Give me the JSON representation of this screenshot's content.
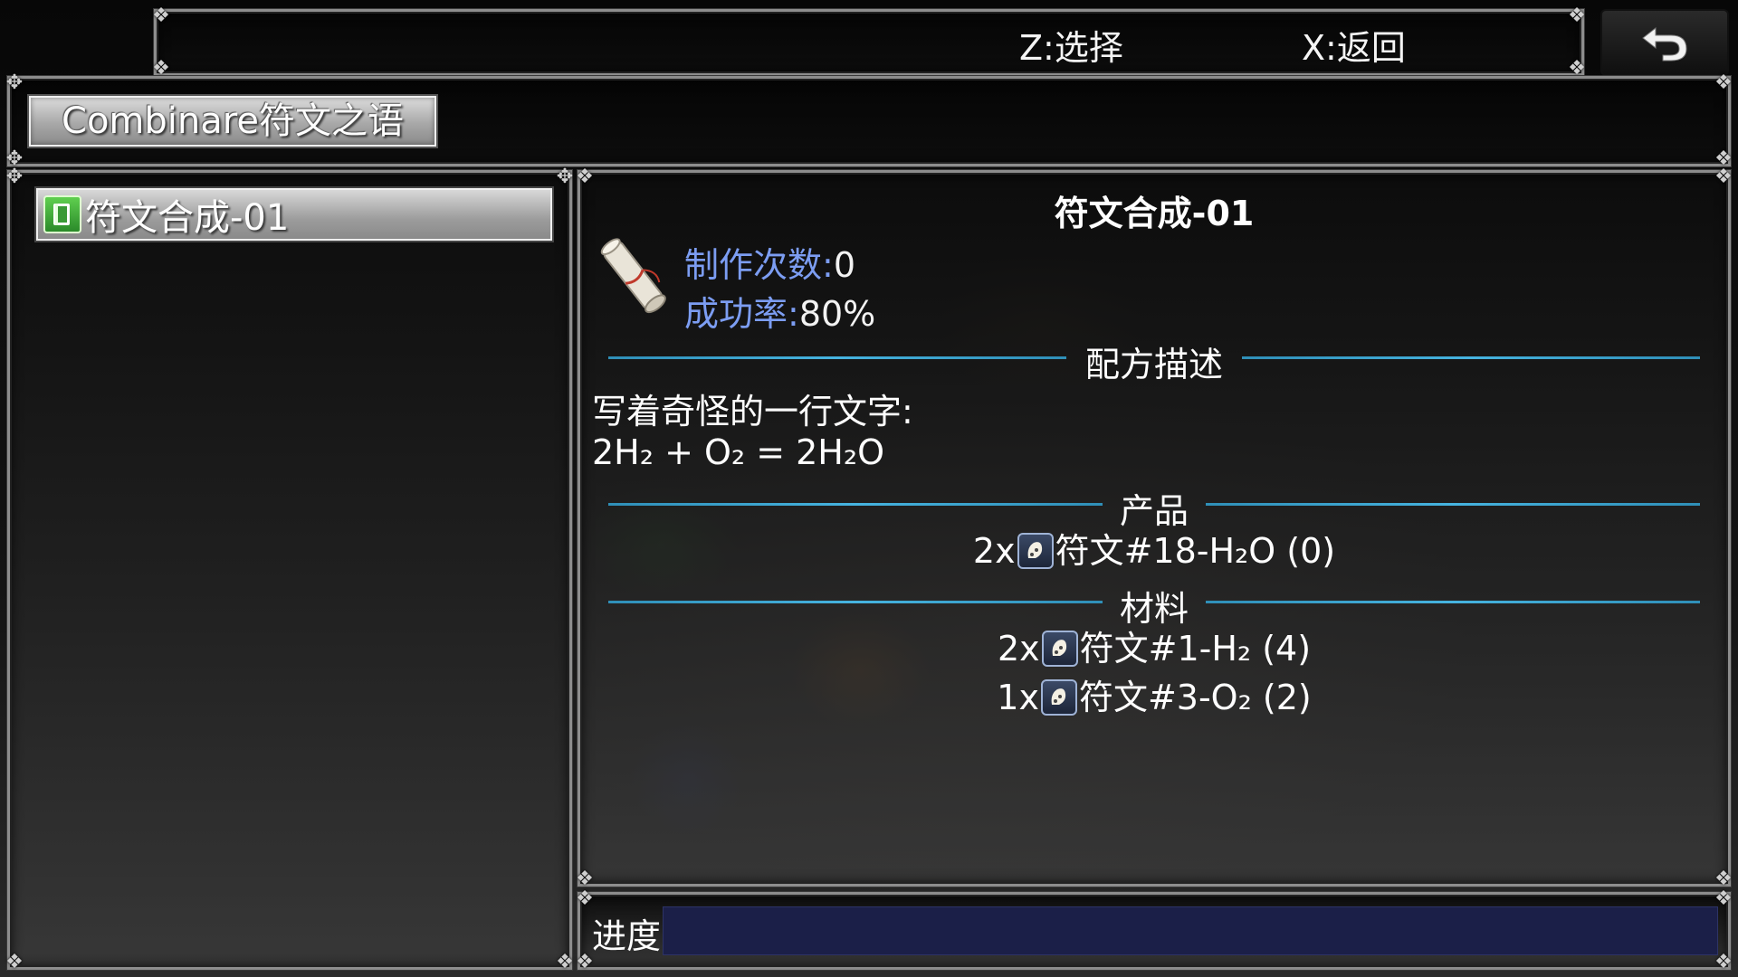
{
  "hints": {
    "select": "Z:选择",
    "back": "X:返回"
  },
  "menu": {
    "title": "Combinare符文之语"
  },
  "recipe_list": [
    {
      "label": "符文合成-01"
    }
  ],
  "detail": {
    "title": "符文合成-01",
    "craft_count_label": "制作次数:",
    "craft_count_value": "0",
    "success_label": "成功率:",
    "success_value": "80%",
    "description_heading": "配方描述",
    "description_line1": "写着奇怪的一行文字:",
    "description_line2": "2H₂ + O₂ = 2H₂O",
    "product_heading": "产品",
    "products": [
      {
        "qty": "2x",
        "name": "符文#18-H₂O (0)"
      }
    ],
    "materials_heading": "材料",
    "materials": [
      {
        "qty": "2x",
        "name": "符文#1-H₂ (4)"
      },
      {
        "qty": "1x",
        "name": "符文#3-O₂ (2)"
      }
    ]
  },
  "progress": {
    "label": "进度",
    "value": 0
  },
  "icons": {
    "back": "undo-arrow-icon",
    "recipe": "green-book-icon",
    "scroll": "scroll-icon",
    "rune": "rune-stone-icon"
  },
  "colors": {
    "stat_key": "#7c9df2",
    "divider": "#46b4e0",
    "progress_track": "#1b1f48"
  }
}
